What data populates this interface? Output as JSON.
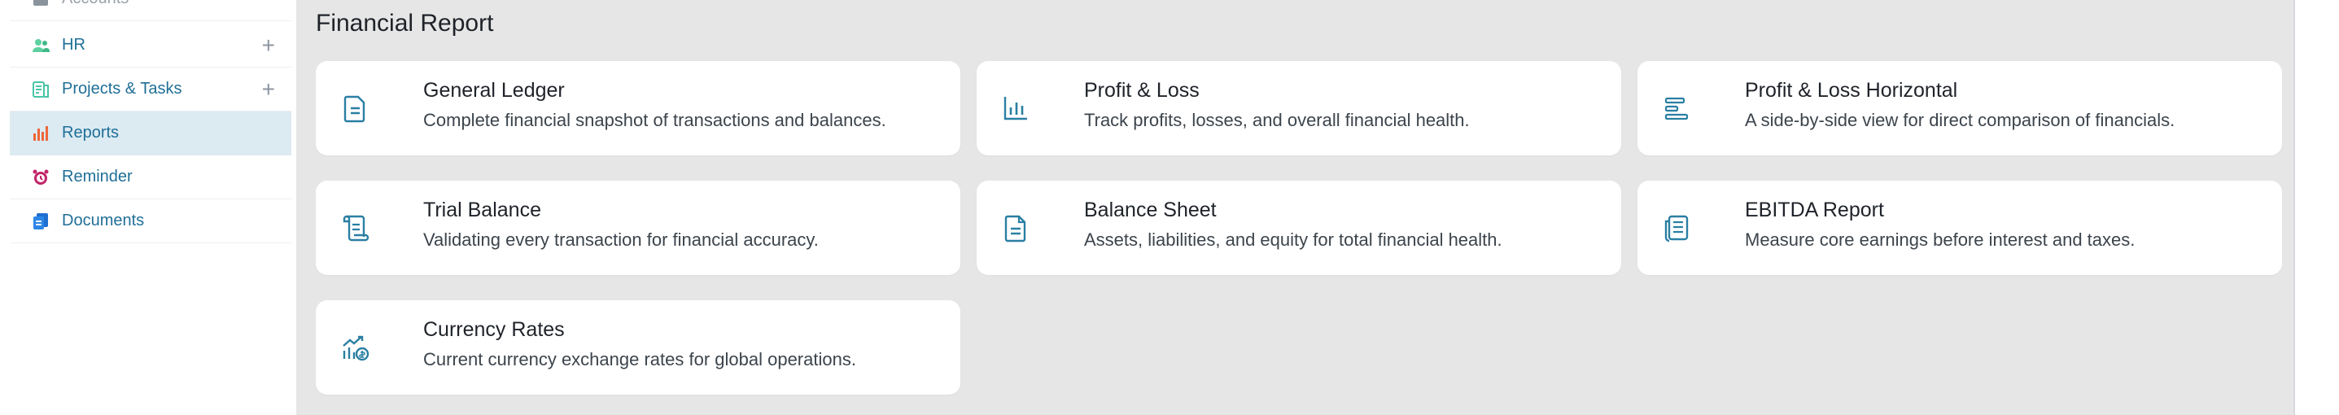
{
  "sidebar": {
    "items": [
      {
        "label": "Accounts",
        "icon": "accounts-icon",
        "state": "faded"
      },
      {
        "label": "HR",
        "icon": "people-icon",
        "has_add": true
      },
      {
        "label": "Projects & Tasks",
        "icon": "projects-icon",
        "has_add": true
      },
      {
        "label": "Reports",
        "icon": "bar-chart-icon",
        "state": "active"
      },
      {
        "label": "Reminder",
        "icon": "alarm-clock-icon"
      },
      {
        "label": "Documents",
        "icon": "documents-icon"
      }
    ],
    "add_symbol": "+"
  },
  "main": {
    "section_title": "Financial Report",
    "cards": [
      {
        "title": "General Ledger",
        "description": "Complete financial snapshot of transactions and balances.",
        "icon": "document-icon"
      },
      {
        "title": "Profit & Loss",
        "description": "Track profits, losses, and overall financial health.",
        "icon": "bar-chart-icon"
      },
      {
        "title": "Profit & Loss Horizontal",
        "description": "A side-by-side view for direct comparison of financials.",
        "icon": "horizontal-bars-icon"
      },
      {
        "title": "Trial Balance",
        "description": "Validating every transaction for financial accuracy.",
        "icon": "scroll-icon"
      },
      {
        "title": "Balance Sheet",
        "description": "Assets, liabilities, and equity for total financial health.",
        "icon": "sheet-icon"
      },
      {
        "title": "EBITDA Report",
        "description": "Measure core earnings before interest and taxes.",
        "icon": "report-list-icon"
      },
      {
        "title": "Currency Rates",
        "description": "Current currency exchange rates for global operations.",
        "icon": "currency-chart-icon"
      }
    ]
  },
  "colors": {
    "accent": "#1f6f97",
    "icon_teal": "#2a7fa3",
    "active_bg": "#dceaf2",
    "page_bg": "#e6e6e6",
    "card_bg": "#ffffff"
  }
}
